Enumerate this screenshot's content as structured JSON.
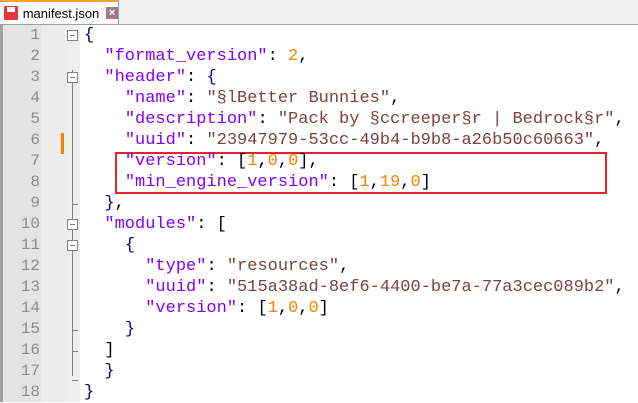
{
  "tab": {
    "title": "manifest.json",
    "close_glyph": "×"
  },
  "colors": {
    "key": "#8000ff",
    "string": "#804040",
    "number": "#ff8000",
    "highlight": "#e8202a",
    "change_marker": "#ff8000"
  },
  "lines": [
    {
      "n": "1",
      "tokens": [
        [
          "b",
          "{"
        ]
      ]
    },
    {
      "n": "2",
      "tokens": [
        [
          "p",
          "  "
        ],
        [
          "k",
          "\"format_version\""
        ],
        [
          "p",
          ": "
        ],
        [
          "n",
          "2"
        ],
        [
          "p",
          ","
        ]
      ]
    },
    {
      "n": "3",
      "tokens": [
        [
          "p",
          "  "
        ],
        [
          "k",
          "\"header\""
        ],
        [
          "p",
          ": "
        ],
        [
          "b",
          "{"
        ]
      ]
    },
    {
      "n": "4",
      "tokens": [
        [
          "p",
          "    "
        ],
        [
          "k",
          "\"name\""
        ],
        [
          "p",
          ": "
        ],
        [
          "s",
          "\"§lBetter Bunnies\""
        ],
        [
          "p",
          ","
        ]
      ]
    },
    {
      "n": "5",
      "tokens": [
        [
          "p",
          "    "
        ],
        [
          "k",
          "\"description\""
        ],
        [
          "p",
          ": "
        ],
        [
          "s",
          "\"Pack by §ccreeper§r | Bedrock§r\""
        ],
        [
          "p",
          ","
        ]
      ]
    },
    {
      "n": "6",
      "tokens": [
        [
          "p",
          "    "
        ],
        [
          "k",
          "\"uuid\""
        ],
        [
          "p",
          ": "
        ],
        [
          "s",
          "\"23947979-53cc-49b4-b9b8-a26b50c60663\""
        ],
        [
          "p",
          ","
        ]
      ]
    },
    {
      "n": "7",
      "tokens": [
        [
          "p",
          "    "
        ],
        [
          "k",
          "\"version\""
        ],
        [
          "p",
          ": ["
        ],
        [
          "n",
          "1"
        ],
        [
          "p",
          ","
        ],
        [
          "n",
          "0"
        ],
        [
          "p",
          ","
        ],
        [
          "n",
          "0"
        ],
        [
          "p",
          "],"
        ]
      ]
    },
    {
      "n": "8",
      "tokens": [
        [
          "p",
          "    "
        ],
        [
          "k",
          "\"min_engine_version\""
        ],
        [
          "p",
          ": ["
        ],
        [
          "n",
          "1"
        ],
        [
          "p",
          ","
        ],
        [
          "n",
          "19"
        ],
        [
          "p",
          ","
        ],
        [
          "n",
          "0"
        ],
        [
          "p",
          "]"
        ]
      ]
    },
    {
      "n": "9",
      "tokens": [
        [
          "p",
          "  "
        ],
        [
          "b",
          "}"
        ],
        [
          "p",
          ","
        ]
      ]
    },
    {
      "n": "10",
      "tokens": [
        [
          "p",
          "  "
        ],
        [
          "k",
          "\"modules\""
        ],
        [
          "p",
          ": ["
        ]
      ]
    },
    {
      "n": "11",
      "tokens": [
        [
          "p",
          "    "
        ],
        [
          "b",
          "{"
        ]
      ]
    },
    {
      "n": "12",
      "tokens": [
        [
          "p",
          "      "
        ],
        [
          "k",
          "\"type\""
        ],
        [
          "p",
          ": "
        ],
        [
          "s",
          "\"resources\""
        ],
        [
          "p",
          ","
        ]
      ]
    },
    {
      "n": "13",
      "tokens": [
        [
          "p",
          "      "
        ],
        [
          "k",
          "\"uuid\""
        ],
        [
          "p",
          ": "
        ],
        [
          "s",
          "\"515a38ad-8ef6-4400-be7a-77a3cec089b2\""
        ],
        [
          "p",
          ","
        ]
      ]
    },
    {
      "n": "14",
      "tokens": [
        [
          "p",
          "      "
        ],
        [
          "k",
          "\"version\""
        ],
        [
          "p",
          ": ["
        ],
        [
          "n",
          "1"
        ],
        [
          "p",
          ","
        ],
        [
          "n",
          "0"
        ],
        [
          "p",
          ","
        ],
        [
          "n",
          "0"
        ],
        [
          "p",
          "]"
        ]
      ]
    },
    {
      "n": "15",
      "tokens": [
        [
          "p",
          "    "
        ],
        [
          "b",
          "}"
        ]
      ]
    },
    {
      "n": "16",
      "tokens": [
        [
          "p",
          "  "
        ],
        [
          "p",
          "]"
        ]
      ]
    },
    {
      "n": "17",
      "tokens": [
        [
          "p",
          "  "
        ],
        [
          "b",
          "}"
        ]
      ]
    },
    {
      "n": "18",
      "tokens": [
        [
          "b",
          "}"
        ]
      ]
    }
  ]
}
